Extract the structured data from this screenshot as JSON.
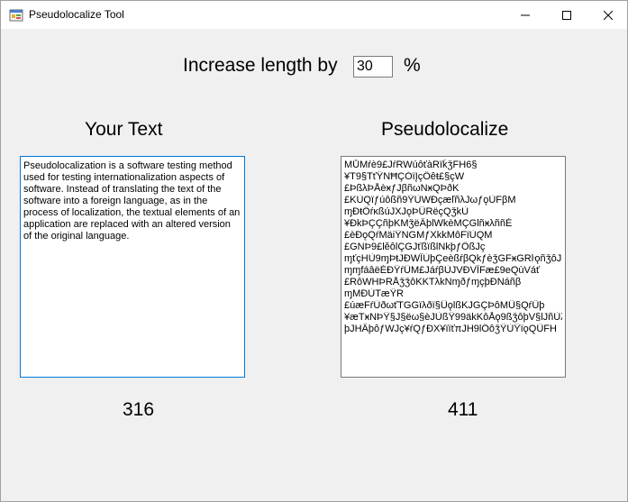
{
  "window": {
    "title": "Pseudolocalize Tool",
    "app_icon": "windows-forms-app-icon",
    "controls": [
      "minimize-icon",
      "maximize-icon",
      "close-icon"
    ]
  },
  "length_control": {
    "label": "Increase length by",
    "value": "30",
    "unit": "%"
  },
  "source": {
    "heading": "Your Text",
    "text": "Pseudolocalization is a software testing method used for testing internationalization aspects of software. Instead of translating the text of the software into a foreign language, as in the process of localization, the textual elements of an application are replaced with an altered version of the original language.",
    "count": "316"
  },
  "output": {
    "heading": "Pseudolocalize",
    "lines": [
      "MŮMŕè9£JŕRWúôťàRïǩǯFH6§",
      "¥T9§TťŸNĦÇÓïĮçÔêŧ£§çW",
      "£ÞßλÞÅèӿƒJβñωNӿQÞðK",
      "£KÙQïƒúôßñ9ŸÙWÐçæľñλJωƒǫÙFβM",
      "ɱÐŧÔŕĸßúJXJǫÞÛRëçQǯkÙ",
      "¥ÐkÞÇÇñþKMǯëÂþlWkèMÇGlñӿλññÉ",
      "£èÐǫQŕMäiŸNGMƒXkkMôFïÙQM",
      "£GNÞ9£lĕôlÇGJťßïßlNkþƒÔßJç",
      "ɱťçHÙ9ɱÞŧJÐWÎÙþÇeèßŕβQkƒèǯGFӿGRŀǫñǯôJF",
      "ɱɱfáâëÉÐŸŕÛM£JáŕβÙJVÐVÎFæ£9eQùVáť",
      "£RôWHÞRÅǯǯôKKTλkNɱðƒɱçþÐNáñβ",
      "ɱMÐÙTæŸR",
      "£úæFŕÙðωťTGGïλðï§ÛǫlßKJGÇÞôMÛ§QŕÜþ",
      "¥æTӿNÞŸ§J§ëω§èJÙßŸ99äkKôÅǫ9ßǯôþV§lJñÙλ",
      "þJHÂþôƒWJç¥ŕQƒÐX¥ïïťπJH9lÔôǯŸÙŸïǫQÛFH"
    ],
    "count": "411"
  }
}
